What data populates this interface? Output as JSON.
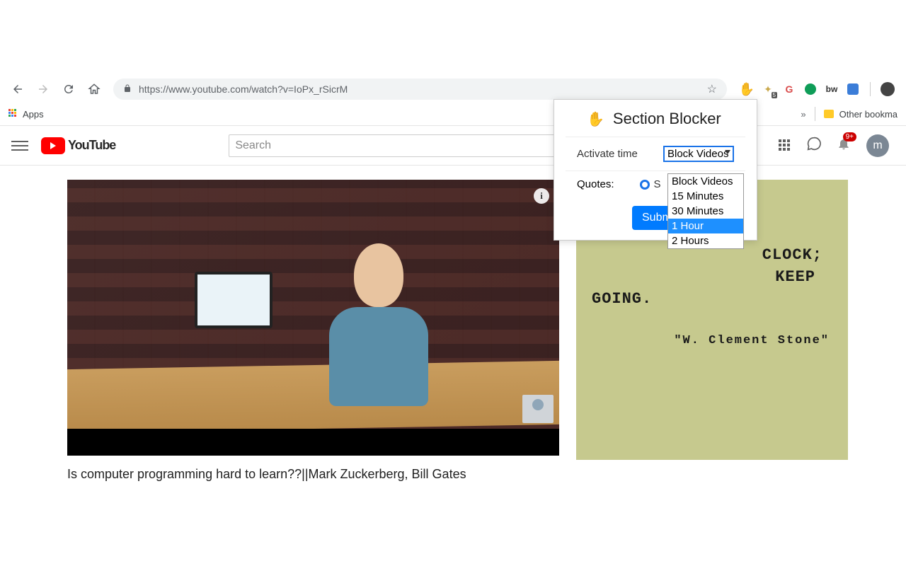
{
  "browser": {
    "url": "https://www.youtube.com/watch?v=IoPx_rSicrM",
    "apps_label": "Apps",
    "other_bookmarks": "Other bookma"
  },
  "youtube": {
    "brand": "YouTube",
    "search_placeholder": "Search",
    "notifications_badge": "9+",
    "avatar_letter": "m",
    "video_title": "Is computer programming hard to learn??||Mark Zuckerberg, Bill Gates"
  },
  "quote": {
    "text_line1": "CLOCK;",
    "text_line2": "KEEP",
    "text_line3": "GOING.",
    "author": "\"W. Clement Stone\""
  },
  "popup": {
    "title": "Section Blocker",
    "activate_label": "Activate time",
    "quotes_label": "Quotes:",
    "selected": "Block Videos",
    "options": [
      "Block Videos",
      "15 Minutes",
      "30 Minutes",
      "1 Hour",
      "2 Hours"
    ],
    "highlighted_index": 3,
    "submit": "Submit"
  },
  "ext_badge": "5"
}
